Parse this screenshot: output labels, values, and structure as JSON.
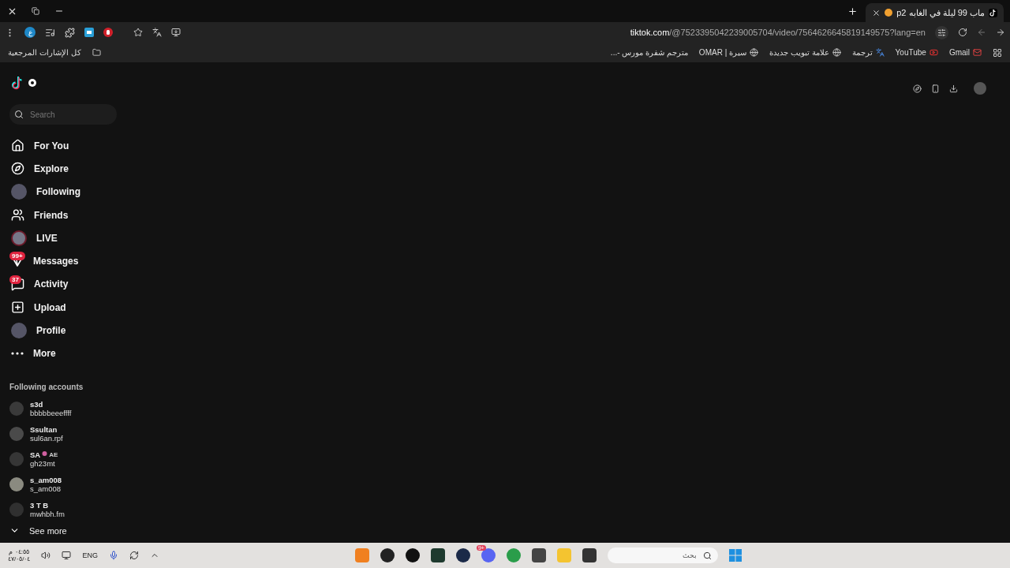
{
  "browser": {
    "tab": {
      "title": "ماب 99 ليلة في الغابه p2",
      "selected": true
    },
    "url": {
      "host": "tiktok.com",
      "path": "/@7523395042239005704/video/7564626645819149575?lang=en"
    },
    "profile_initial": "ع",
    "all_bookmarks": "كل الإشارات المرجعية",
    "bookmarks": [
      {
        "label": "مترجم شفرة مورس -...",
        "kind": "none"
      },
      {
        "label": "سيرة | OMAR",
        "kind": "globe"
      },
      {
        "label": "علامة تبويب جديدة",
        "kind": "globe"
      },
      {
        "label": "ترجمة",
        "kind": "translate"
      },
      {
        "label": "YouTube",
        "kind": "video"
      },
      {
        "label": "Gmail",
        "kind": "mail"
      }
    ]
  },
  "tiktok": {
    "search": {
      "placeholder": "Search"
    },
    "nav": [
      {
        "label": "For You",
        "kind": "home"
      },
      {
        "label": "Explore",
        "kind": "compass"
      },
      {
        "label": "Following",
        "kind": "avatar"
      },
      {
        "label": "Friends",
        "kind": "friends"
      },
      {
        "label": "LIVE",
        "kind": "live"
      },
      {
        "label": "Messages",
        "kind": "messages",
        "badge": "99+"
      },
      {
        "label": "Activity",
        "kind": "activity",
        "badge": "37"
      },
      {
        "label": "Upload",
        "kind": "upload"
      },
      {
        "label": "Profile",
        "kind": "avatar"
      },
      {
        "label": "More",
        "kind": "more"
      }
    ],
    "following_title": "Following accounts",
    "accounts": [
      {
        "name": "s3d",
        "handle": "bbbbbeeeffff"
      },
      {
        "name": "Ssultan",
        "handle": "sul6an.rpf"
      },
      {
        "name": "SA",
        "suffix": "AE",
        "handle": "gh23mt"
      },
      {
        "name": "s_am008",
        "handle": "s_am008"
      },
      {
        "name": "3 T B",
        "handle": "mwhbh.fm"
      }
    ],
    "see_more": "See more"
  },
  "taskbar": {
    "time": "٠٤:٥٥ م",
    "date": "٤٧/٠٥/٠٤",
    "language": "ENG",
    "search": {
      "placeholder": "بحث"
    },
    "discord_badge": "9+"
  }
}
